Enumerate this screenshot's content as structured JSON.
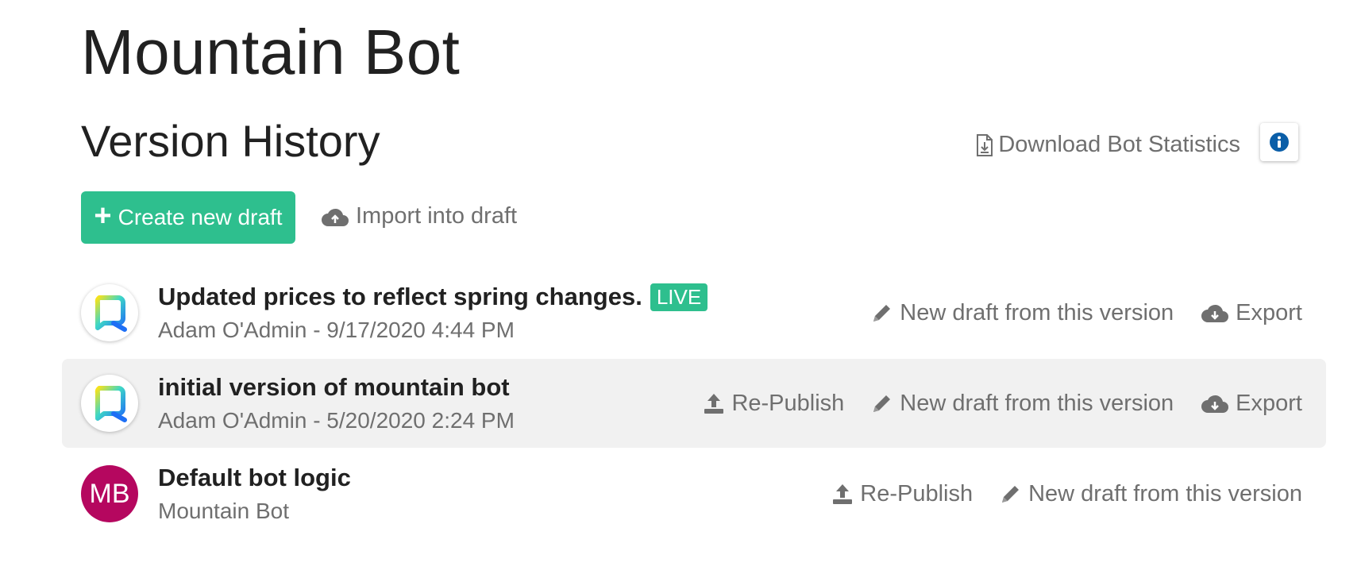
{
  "header": {
    "bot_name": "Mountain Bot",
    "section_title": "Version History",
    "download_label": "Download Bot Statistics",
    "info_icon": "info-icon"
  },
  "toolbar": {
    "create_label": "Create new draft",
    "import_label": "Import into draft"
  },
  "versions": [
    {
      "title": "Updated prices to reflect spring changes.",
      "badge": "LIVE",
      "subtitle": "Adam O'Admin - 9/17/2020 4:44 PM",
      "avatar": "app-logo-icon",
      "new_draft_label": "New draft from this version",
      "export_label": "Export"
    },
    {
      "title": "initial version of mountain bot",
      "subtitle": "Adam O'Admin - 5/20/2020 2:24 PM",
      "avatar": "app-logo-icon",
      "republish_label": "Re-Publish",
      "new_draft_label": "New draft from this version",
      "export_label": "Export"
    },
    {
      "title": "Default bot logic",
      "subtitle": "Mountain Bot",
      "avatar_initials": "MB",
      "avatar_color": "#b5075f",
      "republish_label": "Re-Publish",
      "new_draft_label": "New draft from this version"
    }
  ],
  "colors": {
    "accent": "#2ebf8e",
    "info": "#0a5ea8",
    "muted_text": "#6f6f6f",
    "row_highlight": "#f1f1f1"
  }
}
